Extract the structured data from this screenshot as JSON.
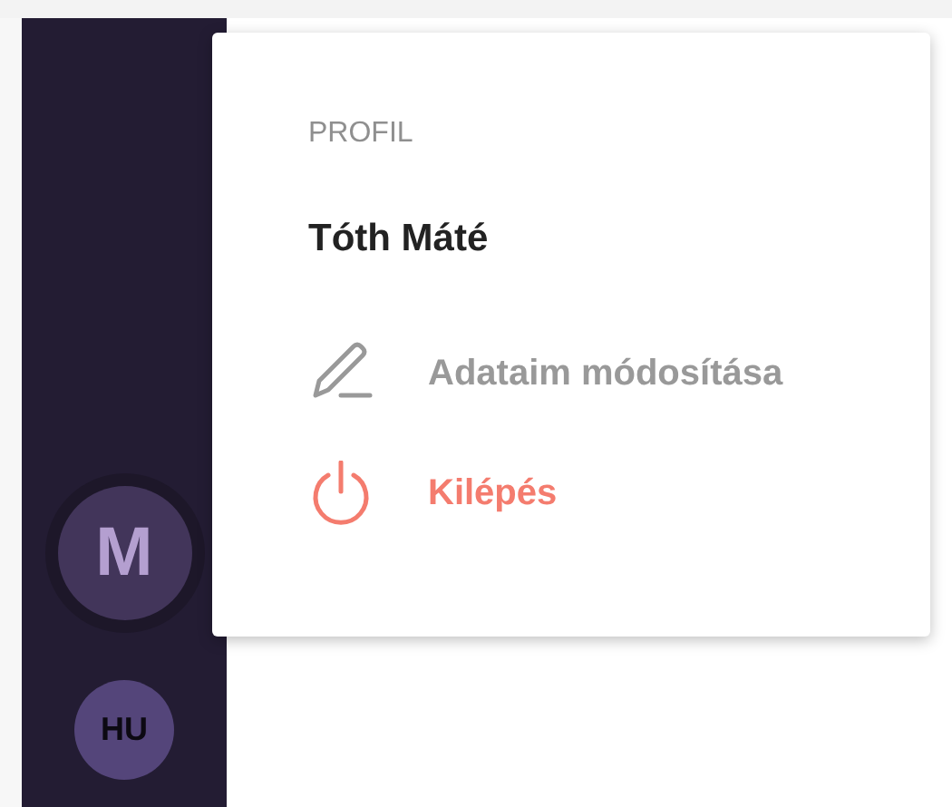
{
  "sidebar": {
    "avatar": {
      "initial": "M"
    },
    "language": "HU"
  },
  "profile_menu": {
    "heading": "PROFIL",
    "user_name": "Tóth Máté",
    "items": [
      {
        "kind": "edit",
        "label": "Adataim módosítása"
      },
      {
        "kind": "logout",
        "label": "Kilépés"
      }
    ]
  }
}
